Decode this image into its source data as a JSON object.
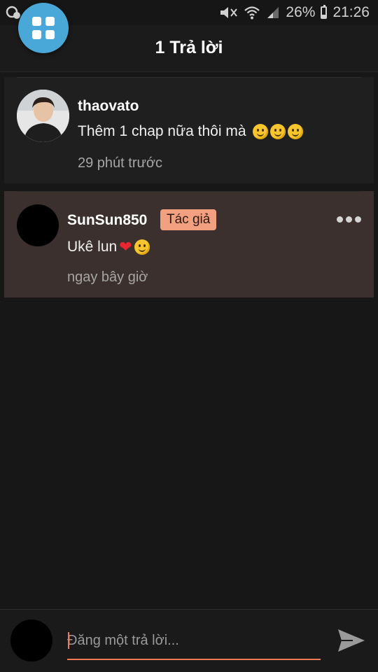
{
  "status_bar": {
    "battery_percent": "26%",
    "battery_level": 0.26,
    "time": "21:26"
  },
  "header": {
    "title": "1 Trả lời",
    "menu_icon": "grid-icon"
  },
  "comments": [
    {
      "username": "thaovato",
      "text": "Thêm 1 chap nữa thôi mà",
      "emojis": [
        "smile",
        "smile",
        "smile"
      ],
      "time": "29 phút trước"
    },
    {
      "username": "SunSun850",
      "badge": "Tác giả",
      "text": "Ukê lun",
      "emojis": [
        "heart",
        "smile"
      ],
      "time": "ngay bây giờ"
    }
  ],
  "reply": {
    "placeholder": "Đăng một trả lời..."
  },
  "colors": {
    "accent": "#ef7b57",
    "fab": "#4aa8d8",
    "badge_bg": "#f2a080",
    "highlight_bg": "#3b302d"
  }
}
